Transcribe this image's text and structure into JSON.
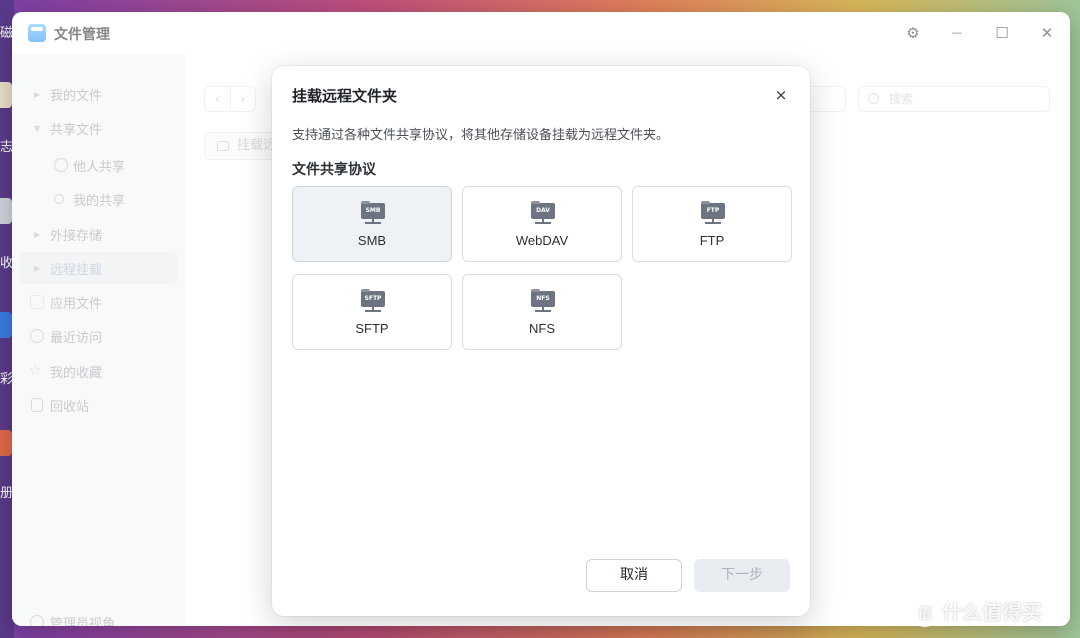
{
  "desktop": {
    "fragments": [
      "磁",
      "志",
      "收",
      "彩",
      "册"
    ]
  },
  "window": {
    "title": "文件管理",
    "controls": {
      "settings": "⚙",
      "maximize": "☐",
      "close": "✕",
      "minimize": "—"
    }
  },
  "sidebar": {
    "items": [
      {
        "label": "我的文件"
      },
      {
        "label": "共享文件"
      },
      {
        "label": "他人共享"
      },
      {
        "label": "我的共享"
      },
      {
        "label": "外接存储"
      },
      {
        "label": "远程挂载"
      },
      {
        "label": "应用文件"
      },
      {
        "label": "最近访问"
      },
      {
        "label": "我的收藏"
      },
      {
        "label": "回收站"
      }
    ],
    "footer": "管理员视角"
  },
  "content": {
    "nav_back": "‹",
    "nav_forward": "›",
    "search_placeholder": "搜索",
    "mount_button": "挂载远"
  },
  "dialog": {
    "title": "挂载远程文件夹",
    "close": "×",
    "description": "支持通过各种文件共享协议，将其他存储设备挂载为远程文件夹。",
    "section_title": "文件共享协议",
    "protocols": [
      {
        "label": "SMB",
        "icon_text": "SMB",
        "selected": true
      },
      {
        "label": "WebDAV",
        "icon_text": "DAV",
        "selected": false
      },
      {
        "label": "FTP",
        "icon_text": "FTP",
        "selected": false
      },
      {
        "label": "SFTP",
        "icon_text": "SFTP",
        "selected": false
      },
      {
        "label": "NFS",
        "icon_text": "NFS",
        "selected": false
      }
    ],
    "cancel_label": "取消",
    "next_label": "下一步"
  },
  "watermark": {
    "logo_char": "值",
    "text": "什么值得买"
  },
  "colors": {
    "selected_bg": "#eef1f5",
    "icon_gray": "#6b7480",
    "disabled_btn": "#e9edf2"
  }
}
